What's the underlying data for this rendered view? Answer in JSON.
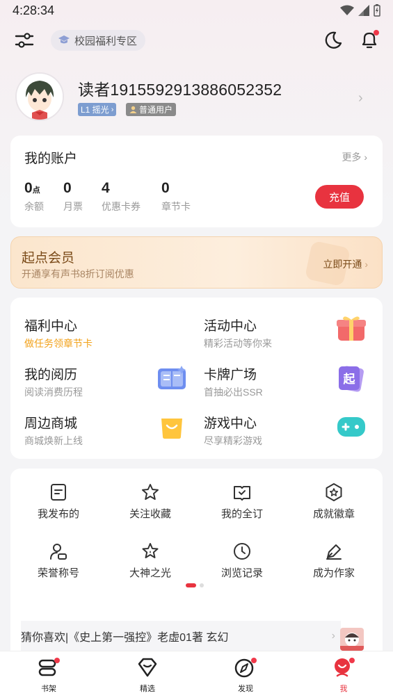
{
  "status": {
    "time": "4:28:34"
  },
  "topbar": {
    "campus_label": "校园福利专区"
  },
  "profile": {
    "username": "读者1915592913886052352",
    "level_badge": "L1 摇光",
    "user_badge": "普通用户"
  },
  "account": {
    "title": "我的账户",
    "more": "更多",
    "stats": [
      {
        "value": "0",
        "unit": "点",
        "label": "余额"
      },
      {
        "value": "0",
        "unit": "",
        "label": "月票"
      },
      {
        "value": "4",
        "unit": "",
        "label": "优惠卡券"
      },
      {
        "value": "0",
        "unit": "",
        "label": "章节卡"
      }
    ],
    "recharge": "充值"
  },
  "vip": {
    "title": "起点会员",
    "subtitle": "开通享有声书8折订阅优惠",
    "open": "立即开通"
  },
  "services": [
    {
      "title": "福利中心",
      "subtitle": "做任务领章节卡",
      "subtitle_color": "#f2a21b",
      "icon": "gift-icon"
    },
    {
      "title": "活动中心",
      "subtitle": "精彩活动等你来",
      "icon": "gift-box-icon"
    },
    {
      "title": "我的阅历",
      "subtitle": "阅读消费历程",
      "icon": "book-history-icon"
    },
    {
      "title": "卡牌广场",
      "subtitle": "首抽必出SSR",
      "icon": "card-icon"
    },
    {
      "title": "周边商城",
      "subtitle": "商城焕新上线",
      "icon": "shopping-bag-icon"
    },
    {
      "title": "游戏中心",
      "subtitle": "尽享精彩游戏",
      "icon": "gamepad-icon"
    }
  ],
  "tools": [
    {
      "label": "我发布的",
      "icon": "document-icon"
    },
    {
      "label": "关注收藏",
      "icon": "star-icon"
    },
    {
      "label": "我的全订",
      "icon": "book-check-icon"
    },
    {
      "label": "成就徽章",
      "icon": "badge-icon"
    },
    {
      "label": "荣誉称号",
      "icon": "person-icon"
    },
    {
      "label": "大神之光",
      "icon": "sparkle-star-icon"
    },
    {
      "label": "浏览记录",
      "icon": "clock-icon"
    },
    {
      "label": "成为作家",
      "icon": "pen-icon"
    }
  ],
  "guess": "猜你喜欢|《史上第一强控》老虚01著 玄幻",
  "nav": [
    {
      "label": "书架",
      "active": false
    },
    {
      "label": "精选",
      "active": false
    },
    {
      "label": "发现",
      "active": false
    },
    {
      "label": "我",
      "active": true
    }
  ],
  "colors": {
    "accent": "#e8333f",
    "vip_text": "#7a4a18",
    "welfare_sub": "#f2a21b"
  }
}
